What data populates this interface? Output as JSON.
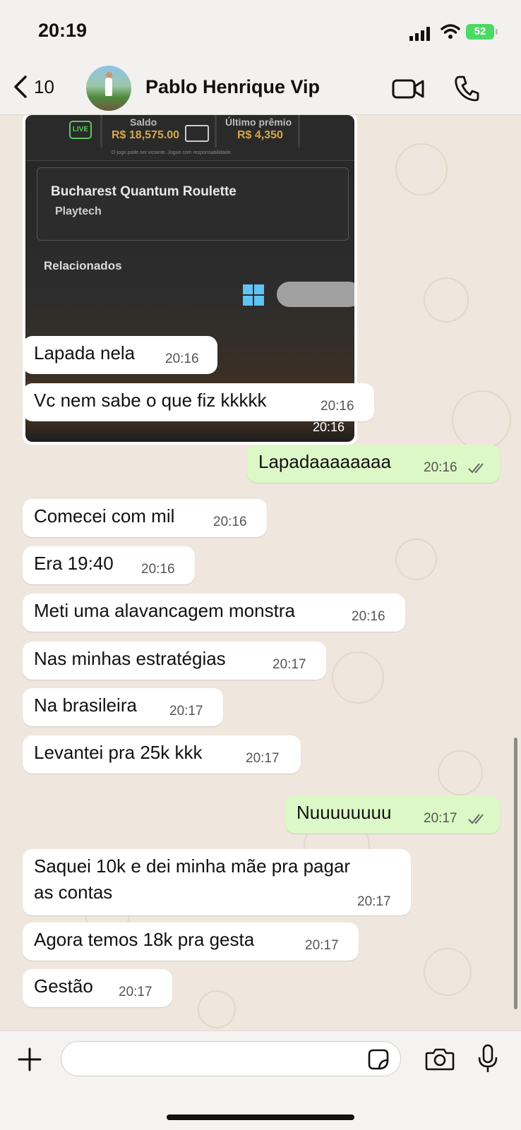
{
  "status": {
    "time": "20:19",
    "battery": "52"
  },
  "header": {
    "back_count": "10",
    "contact_name": "Pablo Henrique Vip"
  },
  "image_message": {
    "live_badge": "LIVE",
    "saldo_label": "Saldo",
    "saldo_value": "R$ 18,575.00",
    "ultimo_label": "Último prêmio",
    "ultimo_value": "R$ 4,350",
    "disclaimer": "O jogo pode ser viciante. Jogue com responsabilidade.",
    "game_title": "Bucharest Quantum Roulette",
    "provider": "Playtech",
    "related": "Relacionados",
    "time": "20:16"
  },
  "messages": [
    {
      "text": "Lapada nela",
      "time": "20:16",
      "outgoing": false
    },
    {
      "text": "Vc nem sabe o que fiz kkkkk",
      "time": "20:16",
      "outgoing": false
    },
    {
      "text": "Lapadaaaaaaaa",
      "time": "20:16",
      "outgoing": true
    },
    {
      "text": "Comecei com mil",
      "time": "20:16",
      "outgoing": false
    },
    {
      "text": "Era 19:40",
      "time": "20:16",
      "outgoing": false
    },
    {
      "text": "Meti uma alavancagem monstra",
      "time": "20:16",
      "outgoing": false
    },
    {
      "text": "Nas minhas estratégias",
      "time": "20:17",
      "outgoing": false
    },
    {
      "text": "Na brasileira",
      "time": "20:17",
      "outgoing": false
    },
    {
      "text": "Levantei pra 25k kkk",
      "time": "20:17",
      "outgoing": false
    },
    {
      "text": "Nuuuuuuuu",
      "time": "20:17",
      "outgoing": true
    },
    {
      "text_line1": "Saquei 10k e dei minha mãe pra pagar",
      "text_line2": "as contas",
      "time": "20:17",
      "outgoing": false
    },
    {
      "text": "Agora temos 18k pra gesta",
      "time": "20:17",
      "outgoing": false
    },
    {
      "text": "Gestão",
      "time": "20:17",
      "outgoing": false
    }
  ],
  "input": {
    "placeholder": ""
  },
  "colors": {
    "outgoing_bubble": "#dcf8c6",
    "incoming_bubble": "#ffffff",
    "wallpaper": "#efe7dd",
    "read_ticks": "#666666"
  },
  "icons": [
    "back-chevron-icon",
    "video-call-icon",
    "phone-icon",
    "plus-icon",
    "sticker-icon",
    "camera-icon",
    "mic-icon",
    "read-ticks-icon"
  ]
}
